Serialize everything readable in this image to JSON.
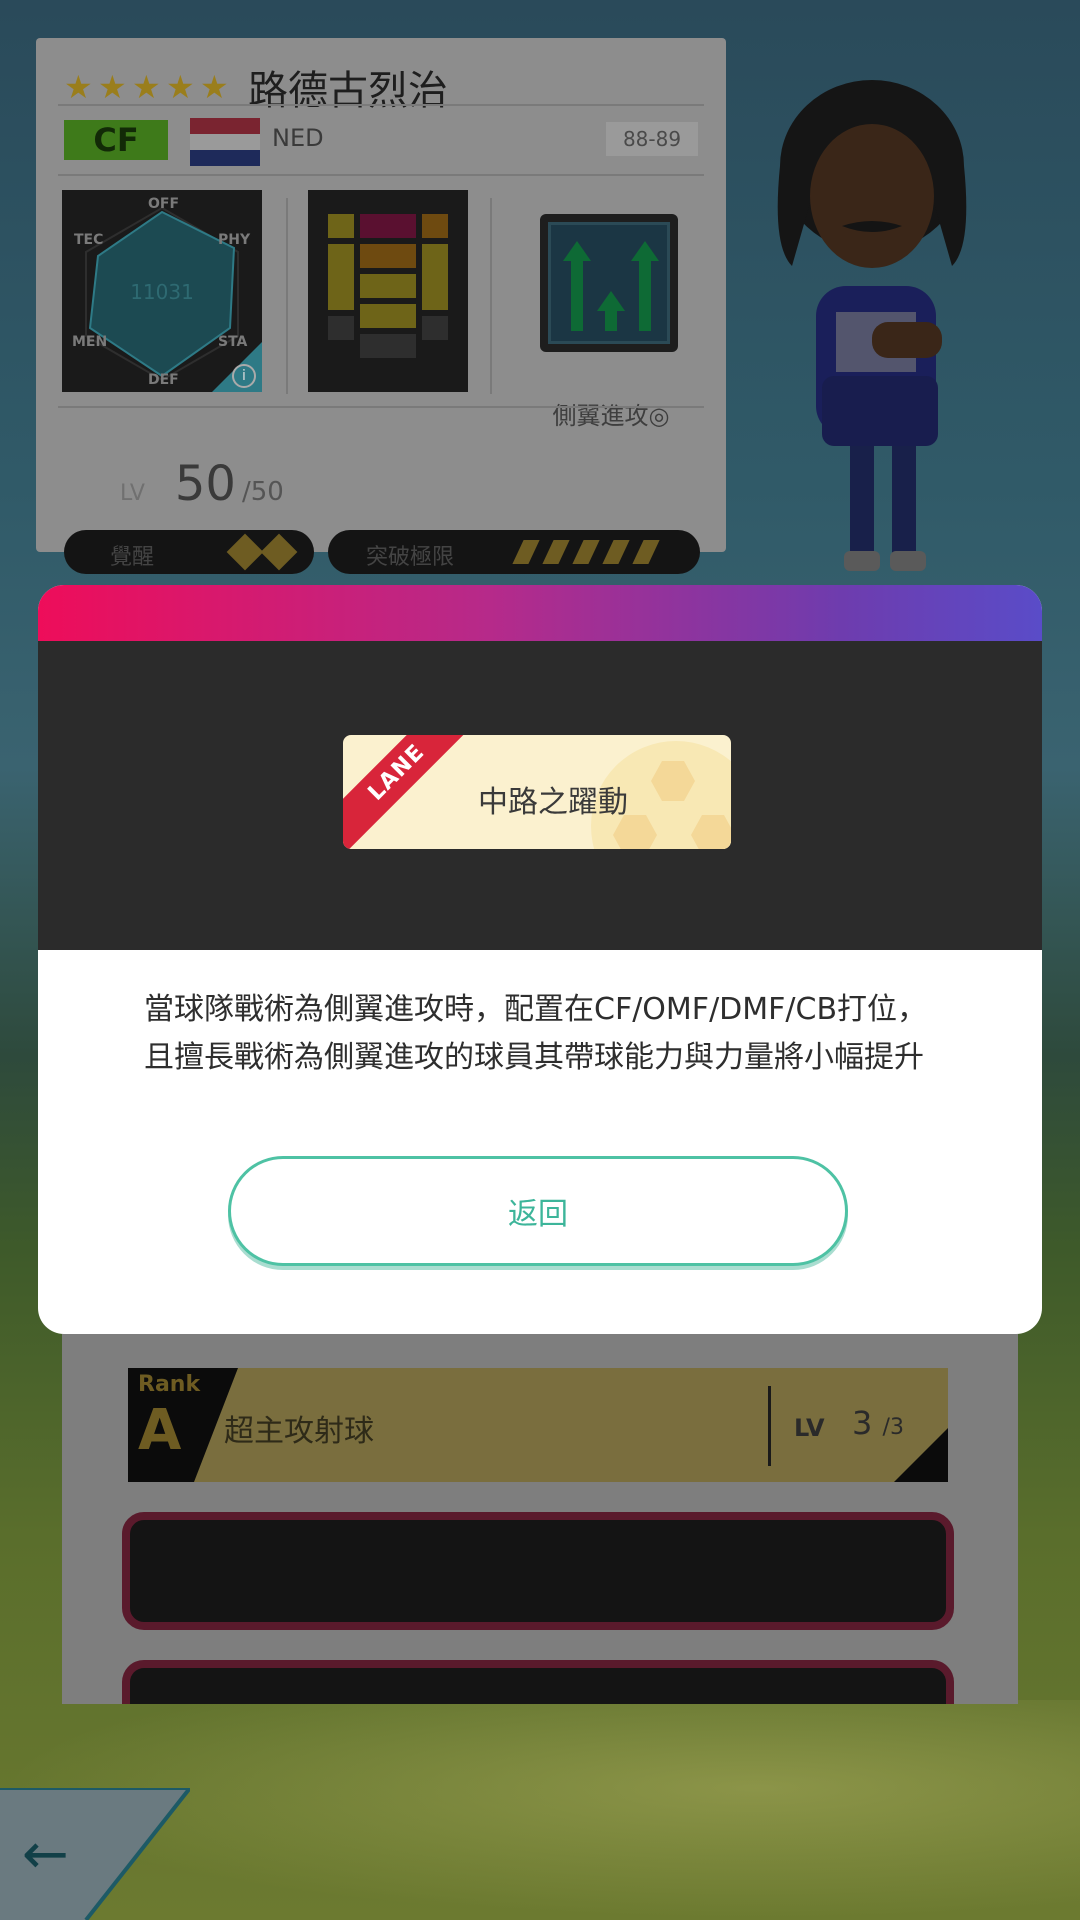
{
  "player": {
    "stars": 5,
    "name": "路德古烈治",
    "position": "CF",
    "nation": "NED",
    "season": "88-89",
    "radar": {
      "labels": {
        "off": "OFF",
        "phy": "PHY",
        "sta": "STA",
        "def": "DEF",
        "men": "MEN",
        "tec": "TEC"
      },
      "total": "11031"
    },
    "tactic_name": "側翼進攻◎",
    "level_label": "LV",
    "level": "50",
    "level_max": "/50",
    "awaken_label": "覺醒",
    "limit_label": "突破極限"
  },
  "skills": [
    {
      "rank_label": "Rank",
      "rank": "A",
      "name": "超主攻射球",
      "lv_label": "LV",
      "lv": "3",
      "lv_max": "/3"
    }
  ],
  "modal": {
    "chip_ribbon": "LANE",
    "chip_title": "中路之躍動",
    "description": "當球隊戰術為側翼進攻時，配置在CF/OMF/DMF/CB打位，且擅長戰術為側翼進攻的球員其帶球能力與力量將小幅提升",
    "return_label": "返回"
  },
  "colors": {
    "accent_teal": "#3db59a",
    "bar_gradient_start": "#ee0d5a",
    "bar_gradient_end": "#5a4cc8",
    "ribbon_red": "#d8253a"
  },
  "icons": {
    "back": "left-arrow-icon",
    "info": "info-icon",
    "tactic": "wing-attack-icon"
  }
}
